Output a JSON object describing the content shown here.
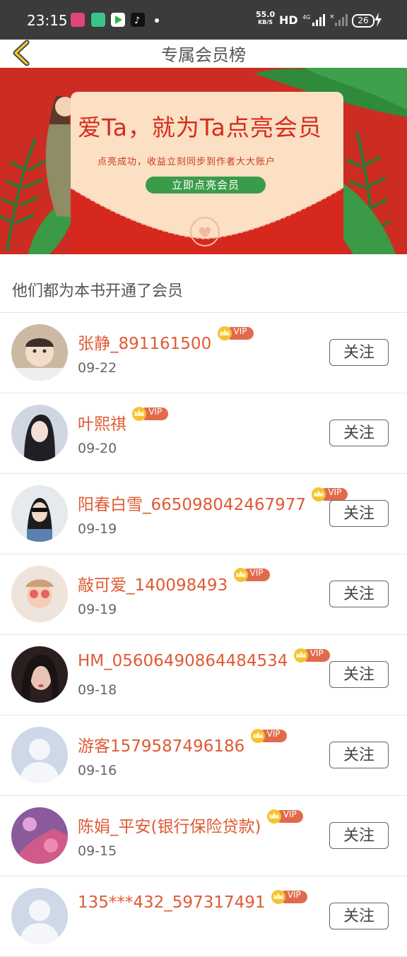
{
  "status_bar": {
    "time": "23:15",
    "speed_value": "55.0",
    "speed_unit": "KB/S",
    "hd": "HD",
    "battery": "26"
  },
  "header": {
    "title": "专属会员榜"
  },
  "banner": {
    "title": "爱Ta，就为Ta点亮会员",
    "subtitle": "点亮成功，收益立刻同步到作者大大账户",
    "button_label": "立即点亮会员"
  },
  "section": {
    "title": "他们都为本书开通了会员"
  },
  "badge": {
    "vip_label": "VIP"
  },
  "follow_label": "关注",
  "members": [
    {
      "name": "张静_891161500",
      "date": "09-22"
    },
    {
      "name": "叶熙祺",
      "date": "09-20"
    },
    {
      "name": "阳春白雪_665098042467977",
      "date": "09-19"
    },
    {
      "name": "敲可爱_140098493",
      "date": "09-19"
    },
    {
      "name": "HM_05606490864484534",
      "date": "09-18"
    },
    {
      "name": "游客1579587496186",
      "date": "09-16"
    },
    {
      "name": "陈娟_平安(银行保险贷款)",
      "date": "09-15"
    },
    {
      "name": "135***432_597317491",
      "date": ""
    }
  ],
  "colors": {
    "accent": "#e05a34",
    "banner_red": "#cc2b22",
    "button_green": "#3a9c4a",
    "status_bar": "#3b3b3b"
  }
}
